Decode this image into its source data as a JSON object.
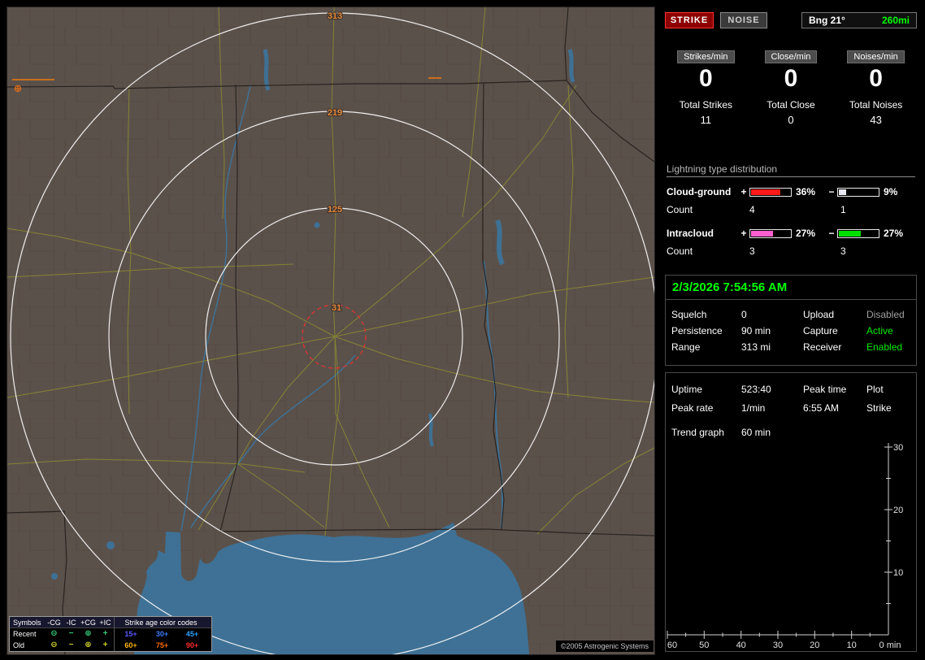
{
  "header": {
    "strike_button": "STRIKE",
    "noise_button": "NOISE",
    "bearing": "Bng 21°",
    "range": "260mi"
  },
  "stats": {
    "columns": [
      {
        "rate_label": "Strikes/min",
        "rate": "0",
        "total_label": "Total Strikes",
        "total": "11"
      },
      {
        "rate_label": "Close/min",
        "rate": "0",
        "total_label": "Total Close",
        "total": "0"
      },
      {
        "rate_label": "Noises/min",
        "rate": "0",
        "total_label": "Total Noises",
        "total": "43"
      }
    ]
  },
  "distribution": {
    "title": "Lightning type distribution",
    "plus_symbol": "+",
    "minus_symbol": "−",
    "rows": [
      {
        "label": "Cloud-ground",
        "plus_pct_label": "36%",
        "plus_fill": "72%",
        "plus_color": "#ff1a1a",
        "minus_pct_label": "9%",
        "minus_fill": "18%",
        "minus_color": "#e8e8f0",
        "count_label": "Count",
        "plus_count": "4",
        "minus_count": "1"
      },
      {
        "label": "Intracloud",
        "plus_pct_label": "27%",
        "plus_fill": "54%",
        "plus_color": "#ff5fd0",
        "minus_pct_label": "27%",
        "minus_fill": "54%",
        "minus_color": "#00e000",
        "count_label": "Count",
        "plus_count": "3",
        "minus_count": "3"
      }
    ]
  },
  "status": {
    "datetime": "2/3/2026 7:54:56 AM",
    "rows": [
      {
        "label": "Squelch",
        "value": "0",
        "label2": "Upload",
        "value2": "Disabled",
        "value2_color": "#a0a0a0"
      },
      {
        "label": "Persistence",
        "value": "90 min",
        "label2": "Capture",
        "value2": "Active",
        "value2_color": "#00ee00"
      },
      {
        "label": "Range",
        "value": "313 mi",
        "label2": "Receiver",
        "value2": "Enabled",
        "value2_color": "#00ee00"
      }
    ]
  },
  "info": {
    "rows": [
      {
        "c1": "Uptime",
        "c2": "523:40",
        "c3": "Peak time",
        "c4": "Plot"
      },
      {
        "c1": "Peak rate",
        "c2": "1/min",
        "c3": "6:55 AM",
        "c4": "Strike"
      }
    ],
    "trend_label": "Trend graph",
    "trend_value": "60 min"
  },
  "chart_data": {
    "type": "line",
    "title": "Trend graph",
    "xlabel": "min",
    "ylabel": "",
    "x_ticks": [
      "60",
      "50",
      "40",
      "30",
      "20",
      "10",
      "0 min"
    ],
    "y_ticks": [
      "30",
      "20",
      "10"
    ],
    "xlim": [
      60,
      0
    ],
    "ylim": [
      0,
      30
    ],
    "grid": false,
    "series": []
  },
  "map": {
    "ring_labels": [
      "313",
      "219",
      "125",
      "31"
    ],
    "copyright": "©2005 Astrogenic Systems",
    "legend": {
      "symbols_header": "Symbols",
      "columns": [
        "-CG",
        "-IC",
        "+CG",
        "+IC"
      ],
      "age_header": "Strike age color codes",
      "symbols": [
        "⊖",
        "−",
        "⊕",
        "+"
      ],
      "rows": [
        {
          "label": "Recent",
          "symbol_color": "#33cc77",
          "ages": [
            {
              "text": "15+",
              "color": "#5858ff"
            },
            {
              "text": "30+",
              "color": "#3d7dff"
            },
            {
              "text": "45+",
              "color": "#2fa1ff"
            }
          ]
        },
        {
          "label": "Old",
          "symbol_color": "#cfcf2a",
          "ages": [
            {
              "text": "60+",
              "color": "#ffb400"
            },
            {
              "text": "75+",
              "color": "#ff6a00"
            },
            {
              "text": "90+",
              "color": "#ff2a2a"
            }
          ]
        }
      ]
    }
  }
}
